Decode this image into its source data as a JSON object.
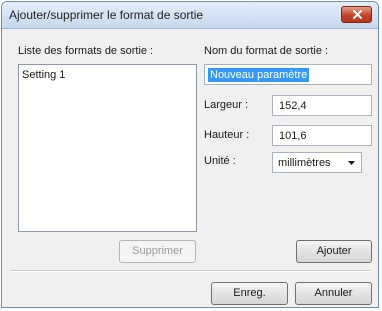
{
  "window": {
    "title": "Ajouter/supprimer le format de sortie"
  },
  "left_panel": {
    "label": "Liste des formats de sortie :",
    "items": [
      {
        "label": "Setting 1"
      }
    ],
    "delete_button": "Supprimer"
  },
  "right_panel": {
    "name_label": "Nom du format de sortie :",
    "name_value": "Nouveau paramètre",
    "width_label": "Largeur :",
    "width_value": "152,4",
    "height_label": "Hauteur :",
    "height_value": "101,6",
    "unit_label": "Unité :",
    "unit_value": "millimètres",
    "add_button": "Ajouter"
  },
  "footer": {
    "save_button": "Enreg.",
    "cancel_button": "Annuler"
  },
  "icons": {
    "close": "close-icon",
    "dropdown": "chevron-down-icon"
  },
  "colors": {
    "selection": "#3399ff",
    "close_button": "#c2432a",
    "title_bar": "#c7d9ee"
  }
}
